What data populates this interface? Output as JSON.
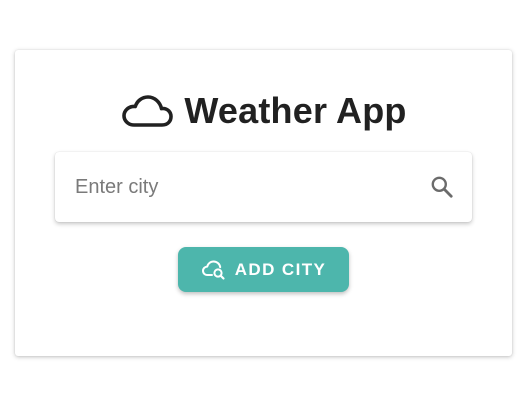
{
  "app": {
    "title": "Weather App",
    "title_icon": "cloud-icon"
  },
  "search": {
    "placeholder": "Enter city",
    "value": "",
    "icon": "search-icon"
  },
  "add_button": {
    "label": "ADD CITY",
    "icon": "cloud-search-icon",
    "color": "#4db6ac"
  },
  "colors": {
    "title_text": "#212121",
    "background": "#ffffff"
  }
}
